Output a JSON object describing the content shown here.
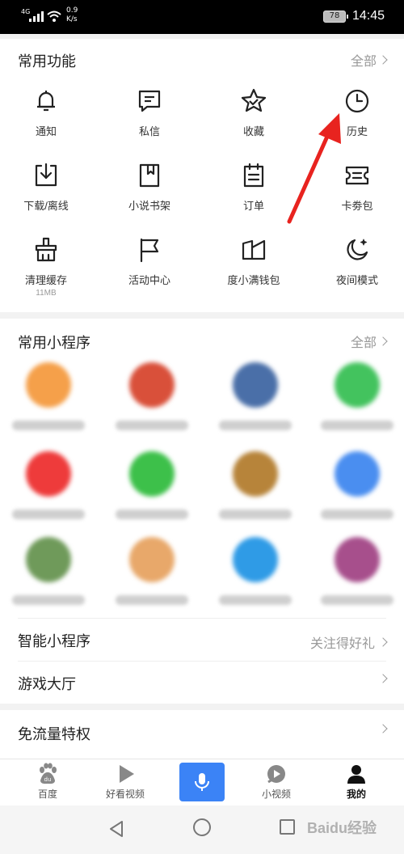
{
  "status_bar": {
    "network": "4G",
    "speed_value": "0.9",
    "speed_unit": "K/s",
    "battery": "78",
    "time": "14:45"
  },
  "common_functions": {
    "title": "常用功能",
    "more": "全部",
    "items": [
      {
        "label": "通知",
        "icon": "bell-icon"
      },
      {
        "label": "私信",
        "icon": "message-icon"
      },
      {
        "label": "收藏",
        "icon": "star-icon"
      },
      {
        "label": "历史",
        "icon": "clock-icon"
      },
      {
        "label": "下载/离线",
        "icon": "download-icon"
      },
      {
        "label": "小说书架",
        "icon": "book-icon"
      },
      {
        "label": "订单",
        "icon": "order-icon"
      },
      {
        "label": "卡劵包",
        "icon": "coupon-icon"
      },
      {
        "label": "清理缓存",
        "sub": "11MB",
        "icon": "broom-icon"
      },
      {
        "label": "活动中心",
        "icon": "flag-icon"
      },
      {
        "label": "度小满钱包",
        "icon": "wallet-icon"
      },
      {
        "label": "夜间模式",
        "icon": "moon-icon"
      }
    ]
  },
  "mini_programs": {
    "title": "常用小程序",
    "more": "全部",
    "items": [
      {
        "color": "#f5a04a"
      },
      {
        "color": "#d9503a"
      },
      {
        "color": "#4a6fa8"
      },
      {
        "color": "#43c35e"
      },
      {
        "color": "#ee3b3b"
      },
      {
        "color": "#3dc04a"
      },
      {
        "color": "#b7843a"
      },
      {
        "color": "#4a8ef0"
      },
      {
        "color": "#6f9a5a"
      },
      {
        "color": "#e8a86a"
      },
      {
        "color": "#2f9be6"
      },
      {
        "color": "#a74f8c"
      }
    ]
  },
  "rows": {
    "smart_mini": {
      "title": "智能小程序",
      "right": "关注得好礼"
    },
    "game_hall": {
      "title": "游戏大厅"
    },
    "free_traffic": {
      "title": "免流量特权"
    }
  },
  "tabbar": {
    "home": "百度",
    "haokan": "好看视频",
    "mini_video": "小视频",
    "mine": "我的"
  },
  "watermark": "Baidu经验",
  "colors": {
    "accent_blue": "#3b83f6",
    "arrow_red": "#e8231f"
  }
}
